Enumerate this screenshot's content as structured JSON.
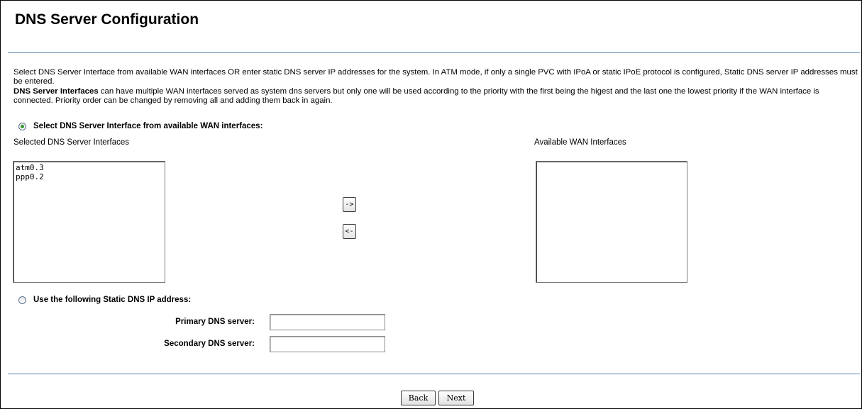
{
  "page": {
    "title": "DNS Server Configuration"
  },
  "description": {
    "line1": "Select DNS Server Interface from available WAN interfaces OR enter static DNS server IP addresses for the system. In ATM mode, if only a single PVC with IPoA or static IPoE protocol is configured, Static DNS server IP addresses must be entered.",
    "bold_term": "DNS Server Interfaces",
    "line2": " can have multiple WAN interfaces served as system dns servers but only one will be used according to the priority with the first being the higest and the last one the lowest priority if the WAN interface is connected. Priority order can be changed by removing all and adding them back in again."
  },
  "interface_option": {
    "label": "Select DNS Server Interface from available WAN interfaces:",
    "selected": true,
    "selected_list_label": "Selected DNS Server Interfaces",
    "available_list_label": "Available WAN Interfaces",
    "selected_items": [
      "atm0.3",
      "ppp0.2"
    ],
    "available_items": [],
    "move_right_label": "->",
    "move_left_label": "<-"
  },
  "static_option": {
    "label": "Use the following Static DNS IP address:",
    "selected": false,
    "primary_label": "Primary DNS server:",
    "primary_value": "",
    "secondary_label": "Secondary DNS server:",
    "secondary_value": ""
  },
  "footer": {
    "back_label": "Back",
    "next_label": "Next"
  },
  "colors": {
    "divider": "#5a86aa",
    "radio_selected": "#2f9a2f"
  }
}
